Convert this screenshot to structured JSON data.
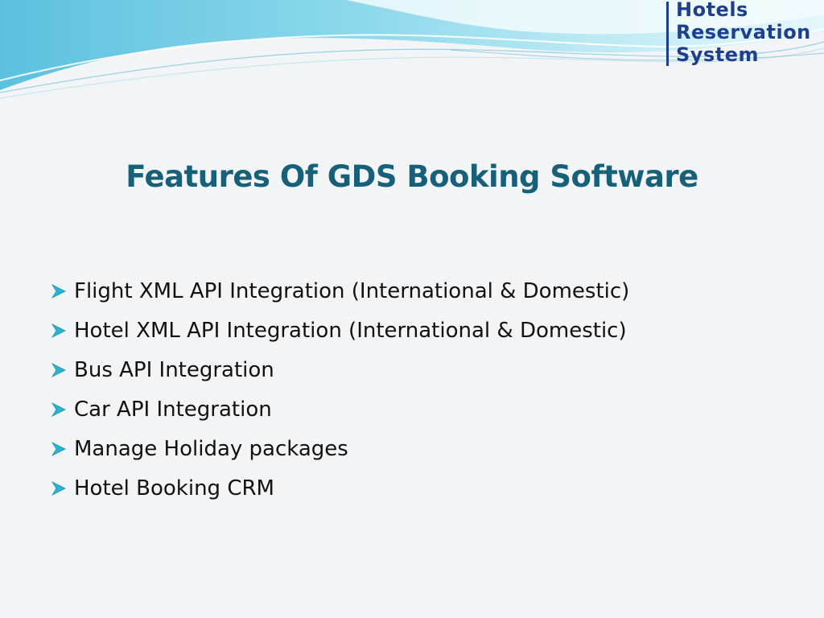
{
  "logo": {
    "line1": "Hotels",
    "line2": "Reservation",
    "line3": "System"
  },
  "title": "Features Of GDS Booking Software",
  "bullets": [
    {
      "text": "Flight XML API Integration (International & Domestic)"
    },
    {
      "text": "Hotel XML API Integration (International & Domestic)"
    },
    {
      "text": "Bus API Integration"
    },
    {
      "text": "Car API Integration"
    },
    {
      "text": "Manage Holiday packages"
    },
    {
      "text": "Hotel Booking CRM"
    }
  ],
  "colors": {
    "title": "#17607a",
    "logo": "#1d3f8e",
    "bullet_icon": "#29b4d4",
    "wave_light": "#c9eef6",
    "wave_mid": "#7fd5ea",
    "wave_dark": "#3aa6cc"
  },
  "icons": {
    "bullet": "arrow-right-icon"
  }
}
